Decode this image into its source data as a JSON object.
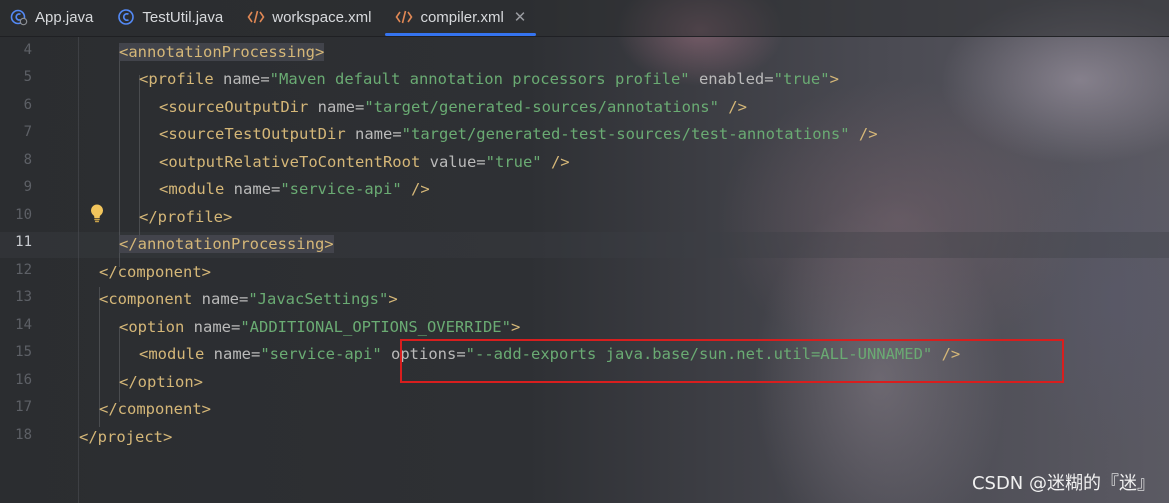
{
  "tabs": [
    {
      "label": "App.java",
      "icon": "java-class-icon"
    },
    {
      "label": "TestUtil.java",
      "icon": "class-icon"
    },
    {
      "label": "workspace.xml",
      "icon": "xml-icon"
    },
    {
      "label": "compiler.xml",
      "icon": "xml-icon",
      "active": true
    }
  ],
  "close_glyph": "✕",
  "line_numbers": [
    "4",
    "5",
    "6",
    "7",
    "8",
    "9",
    "10",
    "11",
    "12",
    "13",
    "14",
    "15",
    "16",
    "17",
    "18"
  ],
  "current_line": "11",
  "code": {
    "l4": {
      "open": "<",
      "tag": "annotationProcessing",
      "close": ">"
    },
    "l5": {
      "open": "<",
      "tag": "profile",
      "a1": " name=",
      "v1": "\"Maven default annotation processors profile\"",
      "a2": " enabled=",
      "v2": "\"true\"",
      "close": ">"
    },
    "l6": {
      "open": "<",
      "tag": "sourceOutputDir",
      "a1": " name=",
      "v1": "\"target/generated-sources/annotations\"",
      "close": " />"
    },
    "l7": {
      "open": "<",
      "tag": "sourceTestOutputDir",
      "a1": " name=",
      "v1": "\"target/generated-test-sources/test-annotations\"",
      "close": " />"
    },
    "l8": {
      "open": "<",
      "tag": "outputRelativeToContentRoot",
      "a1": " value=",
      "v1": "\"true\"",
      "close": " />"
    },
    "l9": {
      "open": "<",
      "tag": "module",
      "a1": " name=",
      "v1": "\"service-api\"",
      "close": " />"
    },
    "l10": {
      "text": "</profile>"
    },
    "l11": {
      "text": "</annotationProcessing>"
    },
    "l12": {
      "text": "</component>"
    },
    "l13": {
      "open": "<",
      "tag": "component",
      "a1": " name=",
      "v1": "\"JavacSettings\"",
      "close": ">"
    },
    "l14": {
      "open": "<",
      "tag": "option",
      "a1": " name=",
      "v1": "\"ADDITIONAL_OPTIONS_OVERRIDE\"",
      "close": ">"
    },
    "l15": {
      "open": "<",
      "tag": "module",
      "a1": " name=",
      "v1": "\"service-api\"",
      "a2": " options=",
      "v2": "\"--add-exports java.base/sun.net.util=ALL-UNNAMED\"",
      "close": " />"
    },
    "l16": {
      "text": "</option>"
    },
    "l17": {
      "text": "</component>"
    },
    "l18": {
      "text": "</project>"
    }
  },
  "watermark": "CSDN @迷糊的『迷』",
  "colors": {
    "tag": "#d5b778",
    "attr": "#bababa",
    "string": "#6aab73",
    "accent": "#3574f0",
    "annotation_box": "#d81e1e"
  }
}
